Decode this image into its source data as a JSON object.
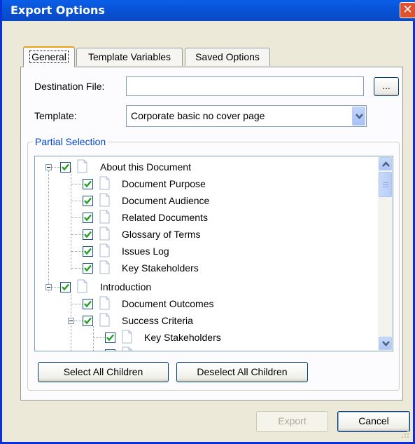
{
  "window": {
    "title": "Export Options",
    "close_glyph": "✕"
  },
  "tabs": [
    {
      "label": "General",
      "active": true
    },
    {
      "label": "Template Variables",
      "active": false
    },
    {
      "label": "Saved Options",
      "active": false
    }
  ],
  "general": {
    "destination_label": "Destination File:",
    "destination_value": "",
    "browse_label": "...",
    "template_label": "Template:",
    "template_value": "Corporate basic no cover page"
  },
  "partial_selection": {
    "title": "Partial Selection",
    "tree": [
      {
        "label": "About this Document",
        "checked": true,
        "expanded": true,
        "level": 0
      },
      {
        "label": "Document Purpose",
        "checked": true,
        "level": 1
      },
      {
        "label": "Document Audience",
        "checked": true,
        "level": 1
      },
      {
        "label": "Related Documents",
        "checked": true,
        "level": 1
      },
      {
        "label": "Glossary of Terms",
        "checked": true,
        "level": 1
      },
      {
        "label": "Issues Log",
        "checked": true,
        "level": 1
      },
      {
        "label": "Key Stakeholders",
        "checked": true,
        "level": 1
      },
      {
        "label": "Introduction",
        "checked": true,
        "expanded": true,
        "level": 0
      },
      {
        "label": "Document Outcomes",
        "checked": true,
        "level": 1
      },
      {
        "label": "Success Criteria",
        "checked": true,
        "expanded": true,
        "level": 1
      },
      {
        "label": "Key Stakeholders",
        "checked": true,
        "level": 2
      }
    ],
    "select_all_label": "Select All Children",
    "deselect_all_label": "Deselect All Children"
  },
  "footer": {
    "export_label": "Export",
    "cancel_label": "Cancel"
  },
  "colors": {
    "title_bar": "#0a5fe8",
    "accent_tab": "#e8a317",
    "group_title": "#0046d5",
    "check": "#21a121",
    "close": "#e0512f"
  },
  "icons": {
    "close": "close-icon",
    "dropdown": "chevron-down-icon",
    "node": "document-icon",
    "check": "checkmark-icon"
  }
}
